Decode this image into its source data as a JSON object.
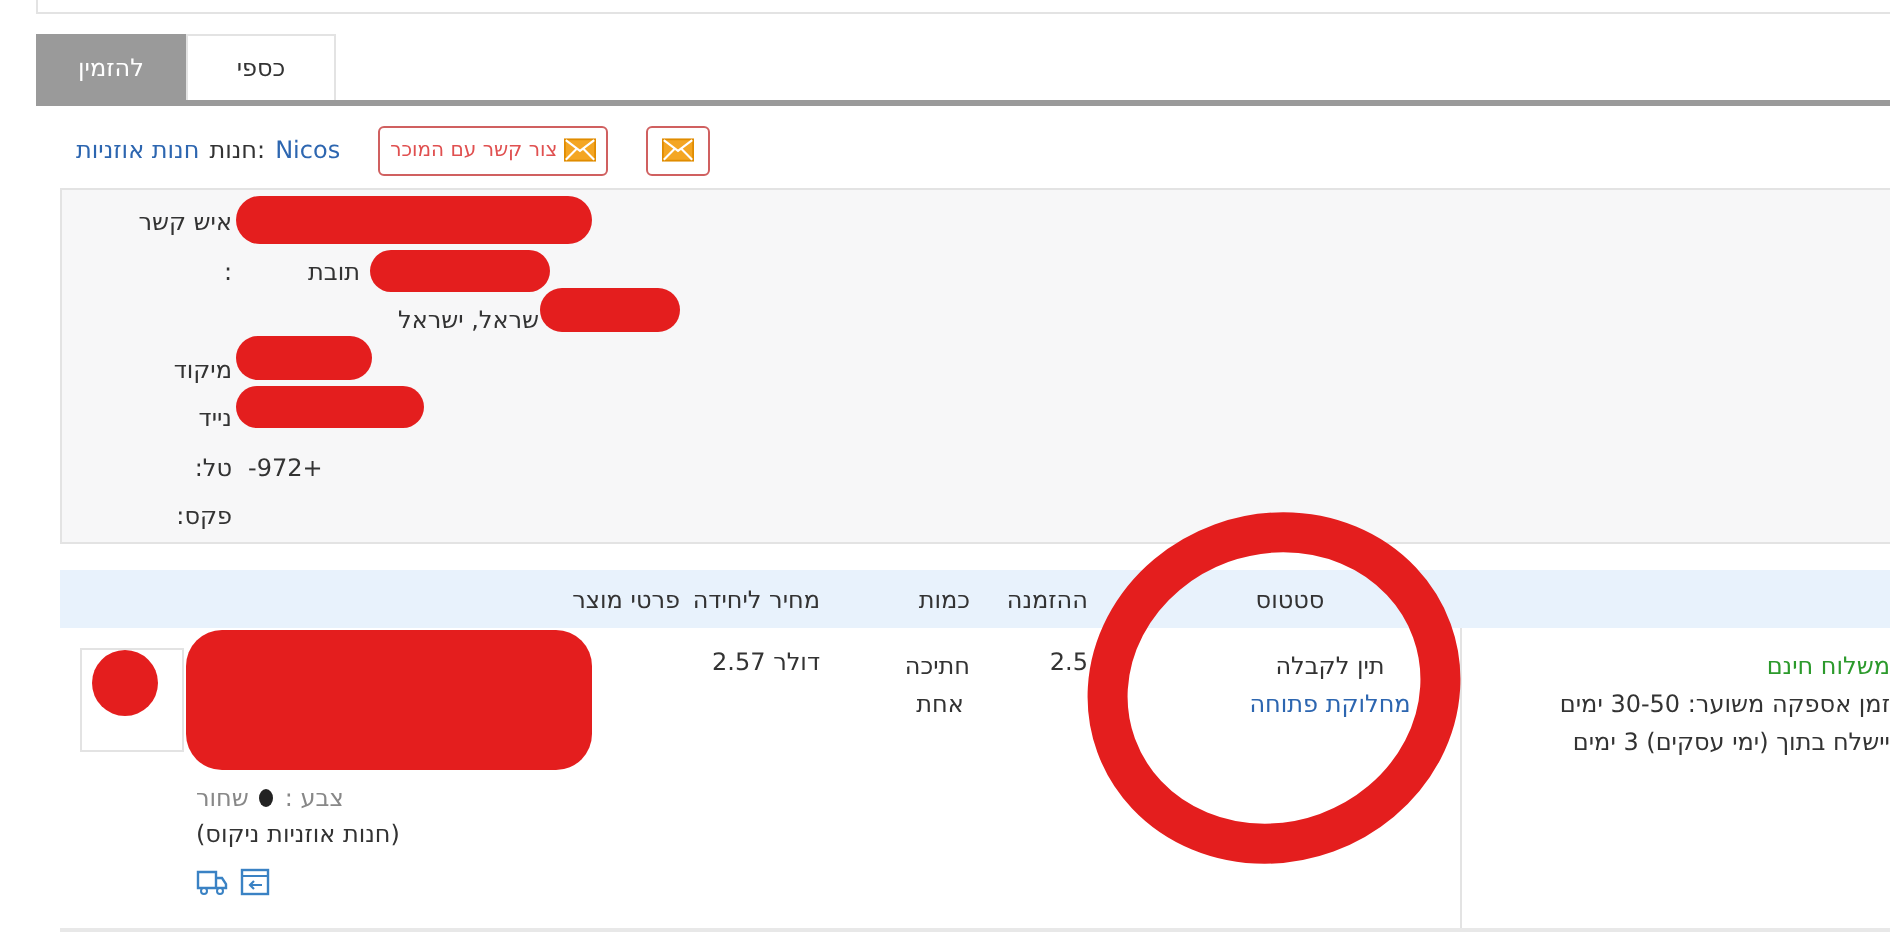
{
  "tabs": [
    {
      "label": "כספי",
      "selected": false
    },
    {
      "label": "להזמין",
      "selected": true
    }
  ],
  "store": {
    "link": "חנות אוזניות",
    "label": "חנות:",
    "name": "Nicos",
    "contact_button": "צור קשר עם המוכר"
  },
  "contact": [
    {
      "label": "איש קשר"
    },
    {
      "label": ":",
      "value": "תובת"
    },
    {
      "value": "שראל, ישראל"
    },
    {
      "label": "מיקוד"
    },
    {
      "label": "נייד"
    },
    {
      "label": "טל:",
      "value": "+972-"
    },
    {
      "label": "פקס:"
    }
  ],
  "table": {
    "columns": [
      "סטטוס",
      "ההזמנה",
      "כמות",
      "מחיר ליחידה",
      "פרטי מוצר"
    ],
    "rows": [
      {
        "color_label": "צבע :",
        "color_value": "שחור",
        "store": "(חנות אוזניות ניקוס)",
        "price": "דולר 2.57",
        "quantity": "חתיכה אחת",
        "total": "2.5",
        "status": "תין לקבלה",
        "dispute_link": "מחלוקת פתוחה",
        "shipping": "משלוח חינם",
        "delivery_estimate": "זמן אספקה משוער: 30-50 ימים",
        "ships_within": "יישלח בתוך (ימי עסקים) 3 ימים"
      }
    ]
  }
}
